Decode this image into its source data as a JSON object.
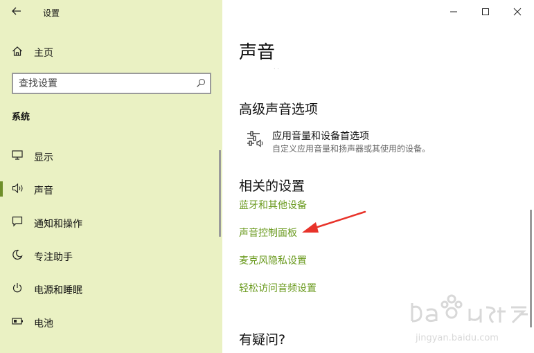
{
  "window": {
    "title": "设置"
  },
  "sidebar": {
    "home_label": "主页",
    "search_placeholder": "查找设置",
    "section_label": "系统",
    "items": [
      {
        "label": "显示",
        "icon": "monitor-icon"
      },
      {
        "label": "声音",
        "icon": "speaker-icon",
        "active": true
      },
      {
        "label": "通知和操作",
        "icon": "notification-icon"
      },
      {
        "label": "专注助手",
        "icon": "moon-icon"
      },
      {
        "label": "电源和睡眠",
        "icon": "power-icon"
      },
      {
        "label": "电池",
        "icon": "battery-icon"
      }
    ]
  },
  "main": {
    "page_title": "声音",
    "advanced_heading": "高级声音选项",
    "app_volume": {
      "title": "应用音量和设备首选项",
      "description": "自定义应用音量和扬声器或其使用的设备。"
    },
    "related_heading": "相关的设置",
    "related_links": [
      "蓝牙和其他设备",
      "声音控制面板",
      "麦克风隐私设置",
      "轻松访问音频设置"
    ],
    "question_heading": "有疑问?"
  },
  "colors": {
    "sidebar_bg": "#eaf1c3",
    "link": "#6a9a1e",
    "accent_bar": "#6f8f2a",
    "annotation_arrow": "#e8332a"
  }
}
